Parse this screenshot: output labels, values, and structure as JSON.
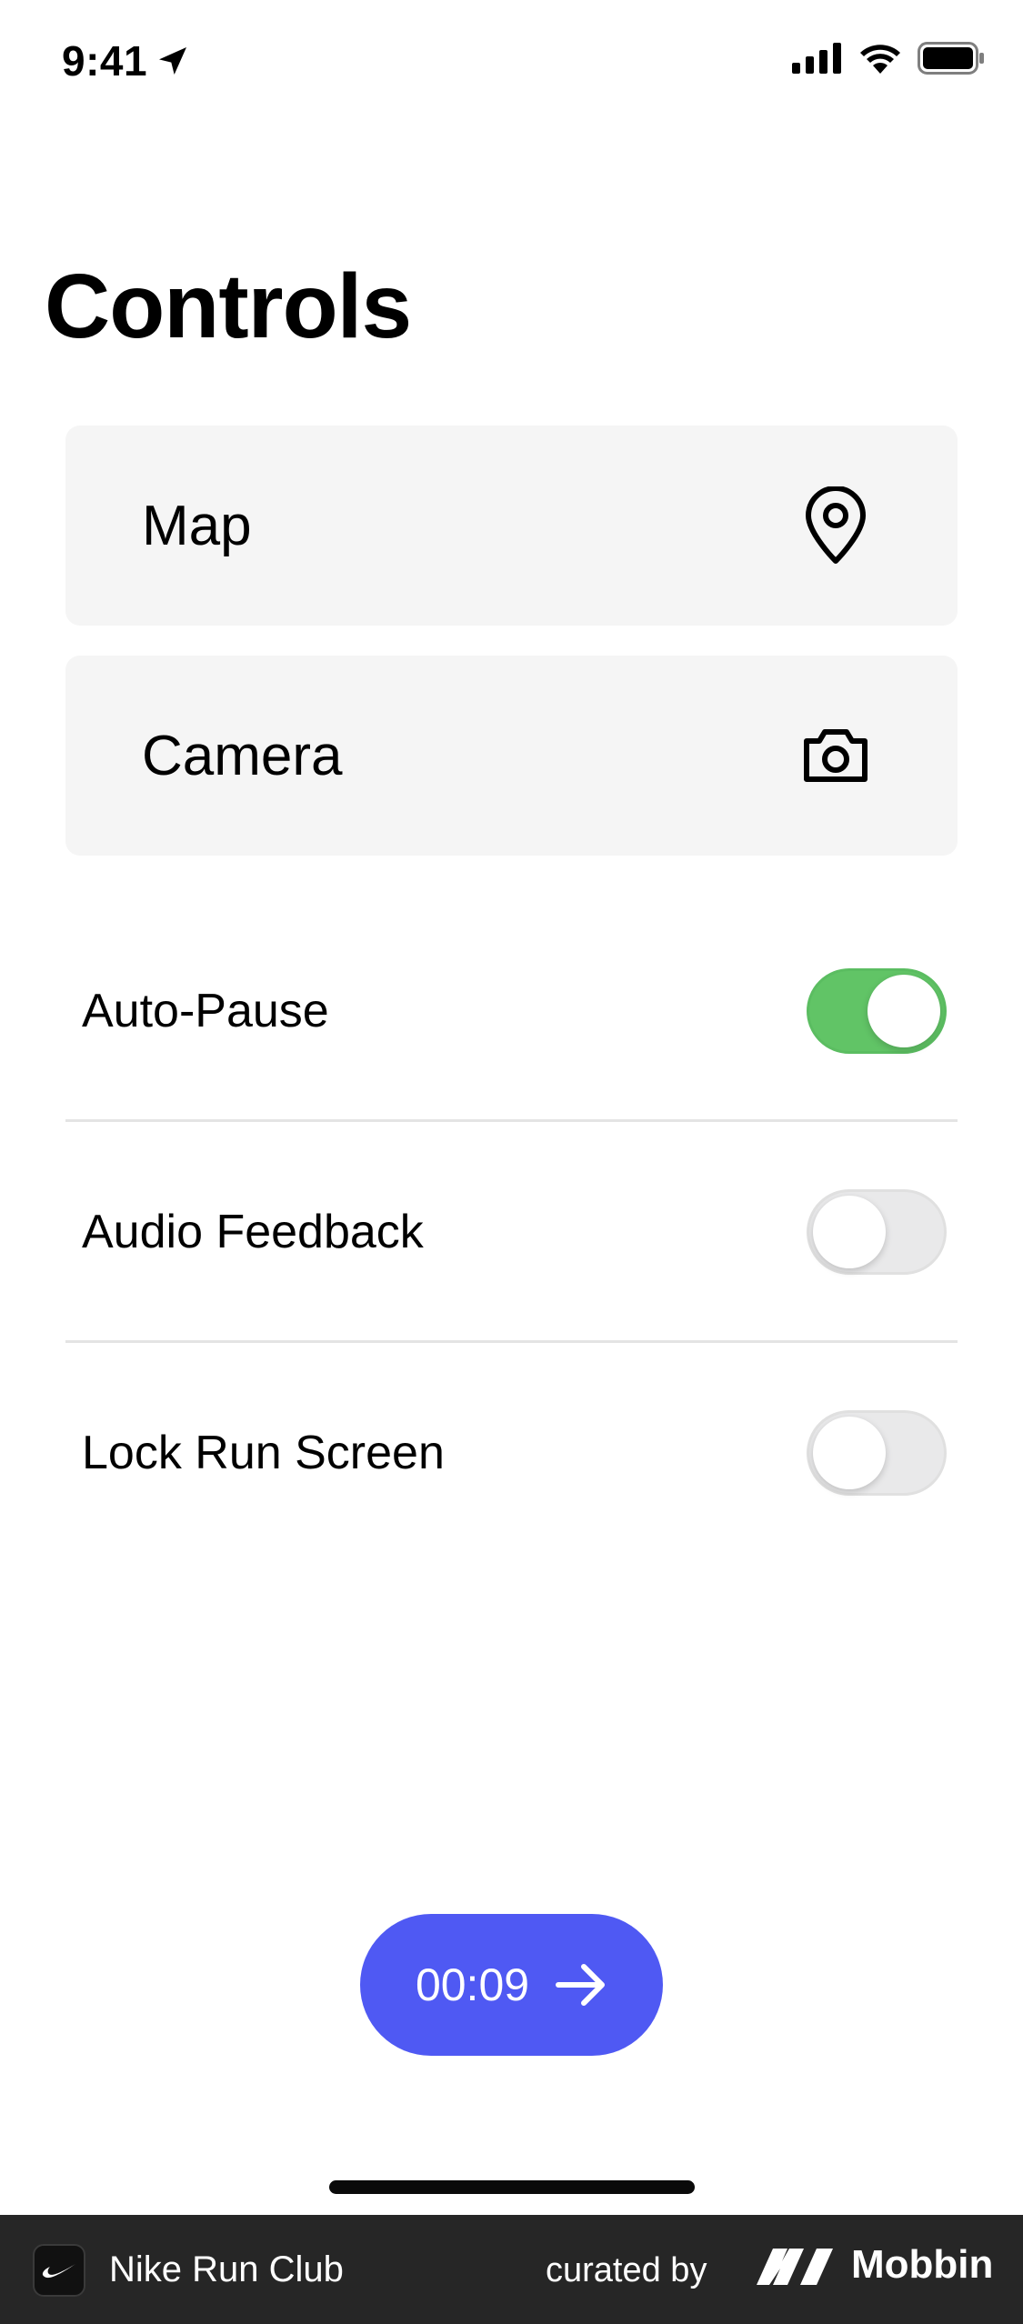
{
  "status_bar": {
    "time": "9:41",
    "icons": [
      "location-arrow-icon",
      "cellular-signal-icon",
      "wifi-icon",
      "battery-icon"
    ]
  },
  "page": {
    "title": "Controls"
  },
  "cards": [
    {
      "label": "Map",
      "icon": "map-pin-icon"
    },
    {
      "label": "Camera",
      "icon": "camera-icon"
    }
  ],
  "toggles": [
    {
      "label": "Auto-Pause",
      "on": true
    },
    {
      "label": "Audio Feedback",
      "on": false
    },
    {
      "label": "Lock Run Screen",
      "on": false
    }
  ],
  "timer": {
    "label": "00:09",
    "icon": "arrow-right-icon"
  },
  "footer": {
    "app_name": "Nike Run Club",
    "curated_by": "curated by",
    "brand": "Mobbin"
  },
  "colors": {
    "accent": "#4f59f3",
    "toggle_on": "#61c466",
    "card_bg": "#f5f5f5",
    "footer_bg": "#262626"
  }
}
